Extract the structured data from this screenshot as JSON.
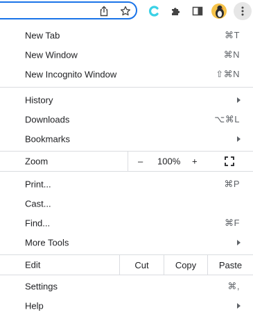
{
  "toolbar": {
    "icons": [
      "share-icon",
      "star-icon",
      "extension-c-icon",
      "puzzle-icon",
      "side-panel-icon",
      "profile-avatar",
      "kebab-menu-icon"
    ]
  },
  "menu": {
    "new_tab": {
      "label": "New Tab",
      "shortcut": "⌘T"
    },
    "new_window": {
      "label": "New Window",
      "shortcut": "⌘N"
    },
    "new_incognito": {
      "label": "New Incognito Window",
      "shortcut": "⇧⌘N"
    },
    "history": {
      "label": "History"
    },
    "downloads": {
      "label": "Downloads",
      "shortcut": "⌥⌘L"
    },
    "bookmarks": {
      "label": "Bookmarks"
    },
    "zoom": {
      "label": "Zoom",
      "minus": "–",
      "value": "100%",
      "plus": "+"
    },
    "print": {
      "label": "Print...",
      "shortcut": "⌘P"
    },
    "cast": {
      "label": "Cast..."
    },
    "find": {
      "label": "Find...",
      "shortcut": "⌘F"
    },
    "more_tools": {
      "label": "More Tools"
    },
    "edit": {
      "label": "Edit",
      "cut": "Cut",
      "copy": "Copy",
      "paste": "Paste"
    },
    "settings": {
      "label": "Settings",
      "shortcut": "⌘,"
    },
    "help": {
      "label": "Help"
    }
  },
  "colors": {
    "accent": "#1a73e8",
    "separator": "#dadce0",
    "text": "#202124",
    "shortcut_text": "#5f6368",
    "extension_c": "#3ad1e6",
    "avatar_bg": "#f6c34a"
  }
}
